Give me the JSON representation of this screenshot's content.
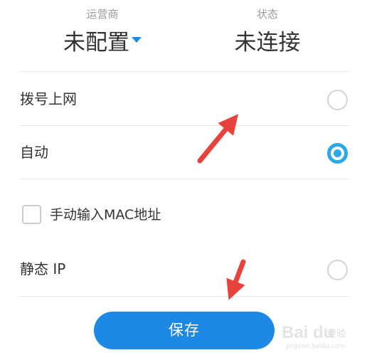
{
  "header": {
    "carrier": {
      "label": "运营商",
      "value": "未配置"
    },
    "status": {
      "label": "状态",
      "value": "未连接"
    }
  },
  "options": [
    {
      "label": "拨号上网",
      "selected": false
    },
    {
      "label": "自动",
      "selected": true
    },
    {
      "label": "静态 IP",
      "selected": false
    }
  ],
  "mac": {
    "label": "手动输入MAC地址",
    "checked": false
  },
  "save": {
    "label": "保存"
  },
  "watermark": {
    "brand": "Bai du",
    "sub": "经验",
    "url": "jingyan.baidu.com"
  },
  "colors": {
    "accent": "#1e88e5",
    "radio_on": "#29a8ea",
    "arrow": "#e8423d",
    "divider": "#e6e6e6"
  }
}
